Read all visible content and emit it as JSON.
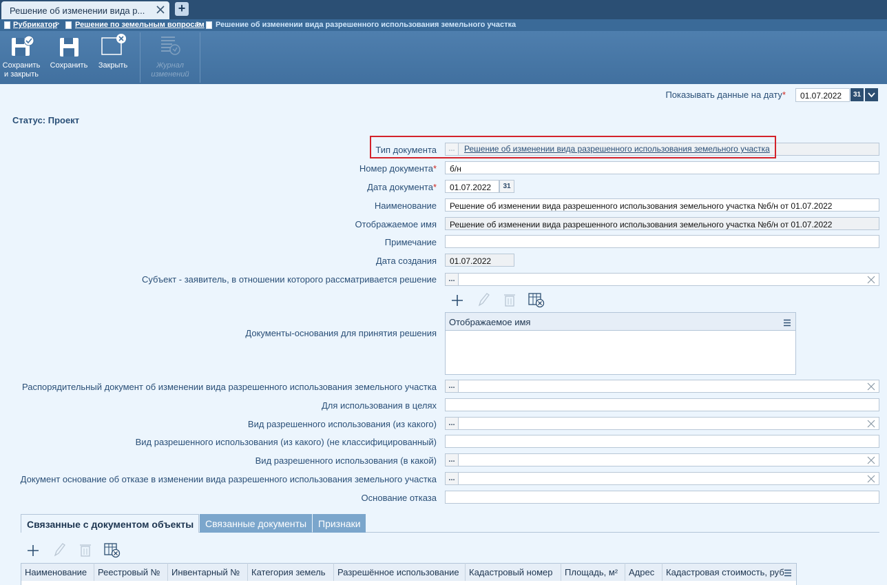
{
  "tab": {
    "title": "Решение об изменении вида р...",
    "add": "+"
  },
  "breadcrumb": {
    "items": [
      "Рубрикатор",
      "Решение по земельным вопросам"
    ],
    "current": "Решение об изменении вида разрешенного использования земельного участка",
    "separator": ">"
  },
  "toolbar": {
    "save_close_1": "Сохранить",
    "save_close_2": "и закрыть",
    "save": "Сохранить",
    "close": "Закрыть",
    "journal_1": "Журнал",
    "journal_2": "изменений"
  },
  "date_filter": {
    "label": "Показывать данные на дату",
    "value": "01.07.2022",
    "cal": "31"
  },
  "status": "Статус: Проект",
  "required_mark": "*",
  "form": {
    "doc_type_label": "Тип документа",
    "doc_type_value": "Решение об изменении вида разрешенного использования земельного участка",
    "number_label": "Номер документа",
    "number_value": "б/н",
    "date_label": "Дата документа",
    "date_value": "01.07.2022",
    "name_label": "Наименование",
    "name_value": "Решение об изменении вида разрешенного использования земельного участка №б/н от 01.07.2022",
    "display_label": "Отображаемое имя",
    "display_value": "Решение об изменении вида разрешенного использования земельного участка №б/н от 01.07.2022",
    "note_label": "Примечание",
    "note_value": "",
    "created_label": "Дата создания",
    "created_value": "01.07.2022",
    "subject_label": "Субъект - заявитель, в отношении которого рассматривается решение",
    "basis_docs_label": "Документы-основания для принятия решения",
    "basis_docs_column": "Отображаемое имя",
    "order_doc_label": "Распорядительный документ об изменении вида разрешенного использования земельного участка",
    "purpose_label": "Для использования в целях",
    "use_from_label": "Вид разрешенного использования (из какого)",
    "use_from_nc_label": "Вид разрешенного использования (из какого) (не классифицированный)",
    "use_to_label": "Вид разрешенного использования (в какой)",
    "refusal_doc_label": "Документ основание об отказе в изменении вида разрешенного использования земельного участка",
    "refusal_reason_label": "Основание отказа",
    "dots": "..."
  },
  "bottom_tabs": [
    "Связанные с документом объекты",
    "Связанные документы",
    "Признаки"
  ],
  "objects_table": {
    "columns": [
      "Наименование",
      "Реестровый №",
      "Инвентарный №",
      "Категория земель",
      "Разрешённое использование",
      "Кадастровый номер",
      "Площадь, м²",
      "Адрес",
      "Кадастровая стоимость, руб"
    ]
  },
  "colors": {
    "accent": "#3a6a98",
    "highlight": "#d3222a",
    "background": "#ecf5fd"
  }
}
